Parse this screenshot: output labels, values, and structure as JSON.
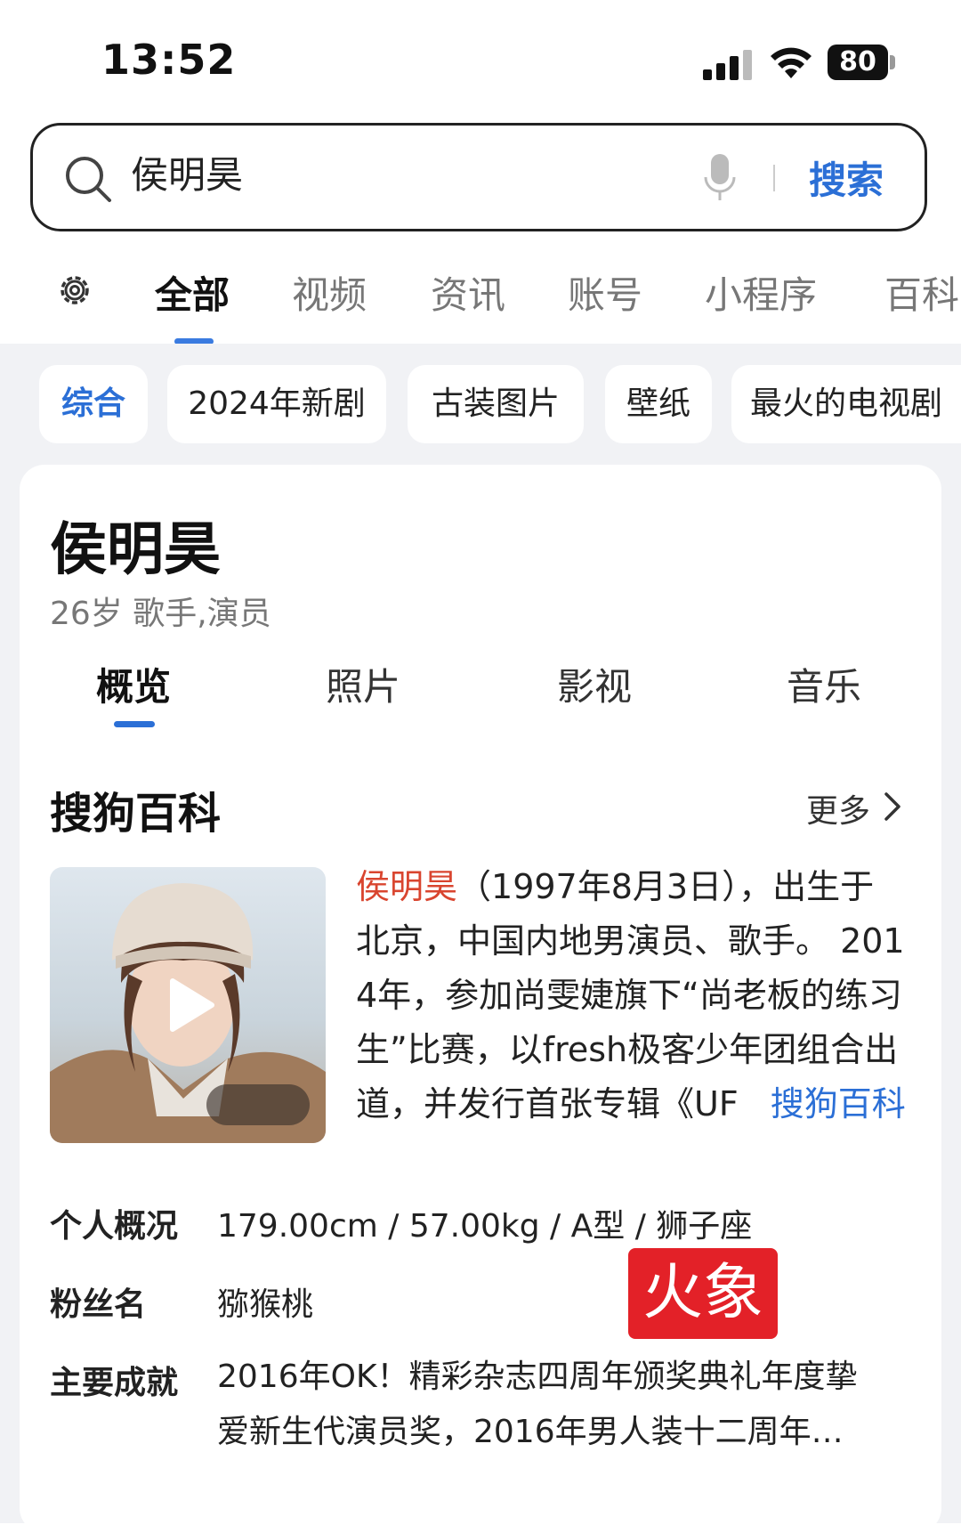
{
  "status_bar": {
    "time": "13:52",
    "battery": "80"
  },
  "search": {
    "query": "侯明昊",
    "button_label": "搜索"
  },
  "main_tabs": [
    {
      "label": "全部",
      "active": true
    },
    {
      "label": "视频"
    },
    {
      "label": "资讯"
    },
    {
      "label": "账号"
    },
    {
      "label": "小程序"
    },
    {
      "label": "百科"
    }
  ],
  "filter_chips": [
    {
      "label": "综合",
      "active": true
    },
    {
      "label": "2024年新剧"
    },
    {
      "label": "古装图片"
    },
    {
      "label": "壁纸"
    },
    {
      "label": "最火的电视剧"
    }
  ],
  "entity": {
    "name": "侯明昊",
    "subtitle": "26岁 歌手,演员",
    "tabs": [
      {
        "label": "概览",
        "active": true
      },
      {
        "label": "照片"
      },
      {
        "label": "影视"
      },
      {
        "label": "音乐"
      }
    ]
  },
  "baike": {
    "title": "搜狗百科",
    "more_label": "更多",
    "intro_name": "侯明昊",
    "intro_line1": "（1997年8月3日），出生于",
    "intro_line2": "北京，中国内地男演员、歌手。 201",
    "intro_line3": "4年，参加尚雯婕旗下“尚老板的练习",
    "intro_line4": "生”比赛，以fresh极客少年团组合出",
    "intro_line5": "道，并发行首张专辑《UF",
    "intro_source": "搜狗百科"
  },
  "info": {
    "profile_label": "个人概况",
    "profile_value": "179.00cm / 57.00kg / A型 / 狮子座",
    "fans_label": "粉丝名",
    "fans_value": "猕猴桃",
    "achievement_label": "主要成就",
    "achievement_line1": "2016年OK！精彩杂志四周年颁奖典礼年度挚",
    "achievement_line2": "爱新生代演员奖，2016年男人装十二周年…",
    "badge": "火象"
  },
  "colors": {
    "accent": "#2b6fd6",
    "highlight": "#d9452f",
    "badge": "#e32128"
  },
  "icons": [
    "search-icon",
    "mic-icon",
    "gear-icon",
    "play-icon",
    "chevron-right-icon"
  ]
}
